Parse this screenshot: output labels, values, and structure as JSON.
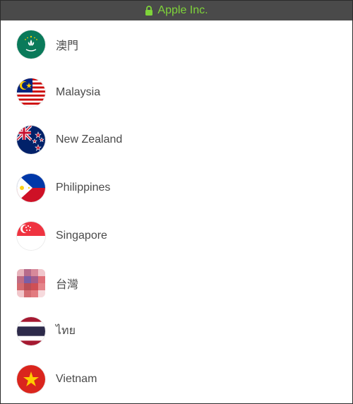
{
  "header": {
    "title": "Apple Inc.",
    "color": "#7fd43a"
  },
  "countries": [
    {
      "label": "澳門",
      "flag": "macau-flag-icon"
    },
    {
      "label": "Malaysia",
      "flag": "malaysia-flag-icon"
    },
    {
      "label": "New Zealand",
      "flag": "new-zealand-flag-icon"
    },
    {
      "label": "Philippines",
      "flag": "philippines-flag-icon"
    },
    {
      "label": "Singapore",
      "flag": "singapore-flag-icon"
    },
    {
      "label": "台灣",
      "flag": "taiwan-flag-icon"
    },
    {
      "label": "ไทย",
      "flag": "thailand-flag-icon"
    },
    {
      "label": "Vietnam",
      "flag": "vietnam-flag-icon"
    }
  ]
}
